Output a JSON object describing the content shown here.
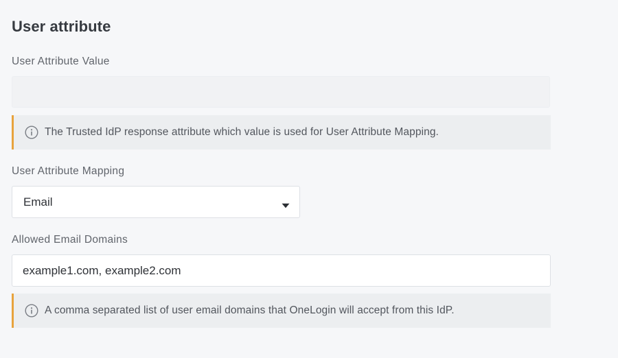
{
  "section": {
    "title": "User attribute"
  },
  "user_attribute_value": {
    "label": "User Attribute Value",
    "value": "",
    "info_icon": "info-circle-icon",
    "help_text": "The Trusted IdP response attribute which value is used for User Attribute Mapping."
  },
  "user_attribute_mapping": {
    "label": "User Attribute Mapping",
    "selected": "Email",
    "caret_icon": "caret-down-icon"
  },
  "allowed_email_domains": {
    "label": "Allowed Email Domains",
    "value": "example1.com, example2.com",
    "info_icon": "info-circle-icon",
    "help_text": "A comma separated list of user email domains that OneLogin will accept from this IdP."
  },
  "colors": {
    "background": "#f6f7f9",
    "info_accent": "#e8a33d",
    "info_background": "#eceef0"
  }
}
